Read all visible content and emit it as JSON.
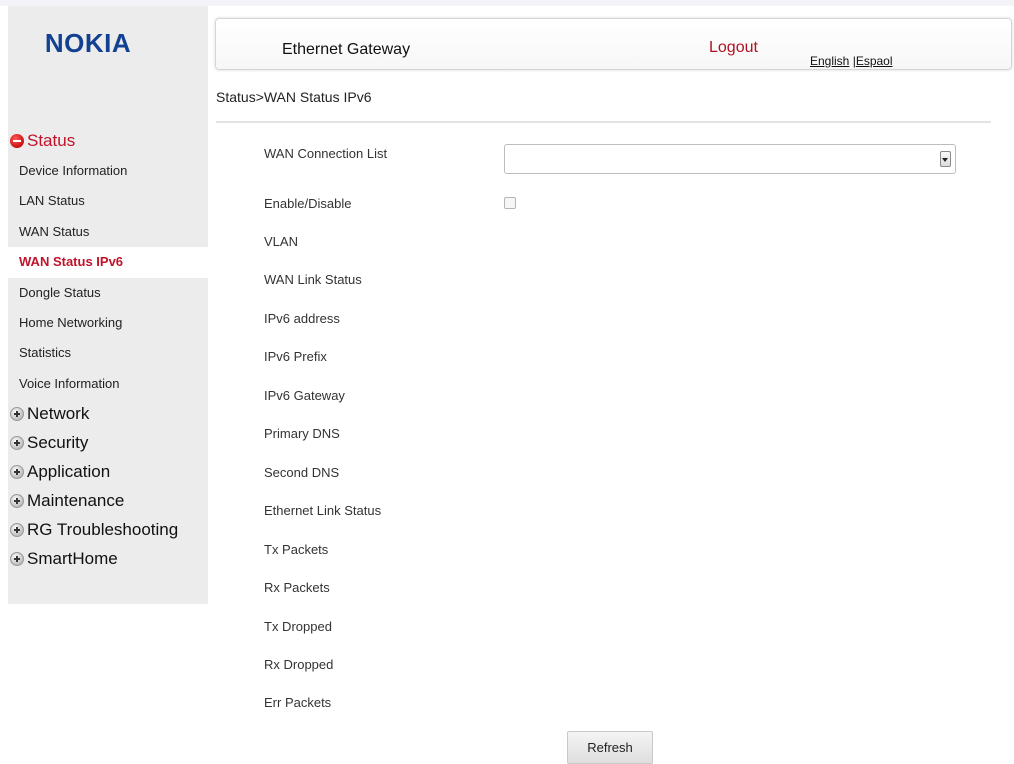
{
  "brand": {
    "logo_text": "NOKIA"
  },
  "header": {
    "title": "Ethernet Gateway",
    "logout_label": "Logout",
    "lang_english": "English",
    "lang_separator": " |",
    "lang_spanish": "Espaol"
  },
  "breadcrumb": "Status>WAN Status IPv6",
  "sidebar": {
    "status_group": "Status",
    "status_items": [
      "Device Information",
      "LAN Status",
      "WAN Status",
      "WAN Status IPv6",
      "Dongle Status",
      "Home Networking",
      "Statistics",
      "Voice Information"
    ],
    "active_item": "WAN Status IPv6",
    "groups": [
      "Network",
      "Security",
      "Application",
      "Maintenance",
      "RG Troubleshooting",
      "SmartHome"
    ]
  },
  "form": {
    "wan_connection_list": "WAN Connection List",
    "enable_disable": "Enable/Disable",
    "fields": [
      "VLAN",
      "WAN Link Status",
      "IPv6 address",
      "IPv6 Prefix",
      "IPv6 Gateway",
      "Primary DNS",
      "Second DNS",
      "Ethernet Link Status",
      "Tx Packets",
      "Rx Packets",
      "Tx Dropped",
      "Rx Dropped",
      "Err Packets"
    ],
    "selected_connection": "",
    "enabled": false,
    "refresh_label": "Refresh"
  },
  "icons": {
    "expanded": "minus-circle-icon",
    "collapsed": "plus-circle-icon",
    "dropdown": "chevron-down-icon"
  },
  "colors": {
    "brand": "#124191",
    "accent_red": "#c0132a",
    "sidebar_bg": "#ececec"
  }
}
